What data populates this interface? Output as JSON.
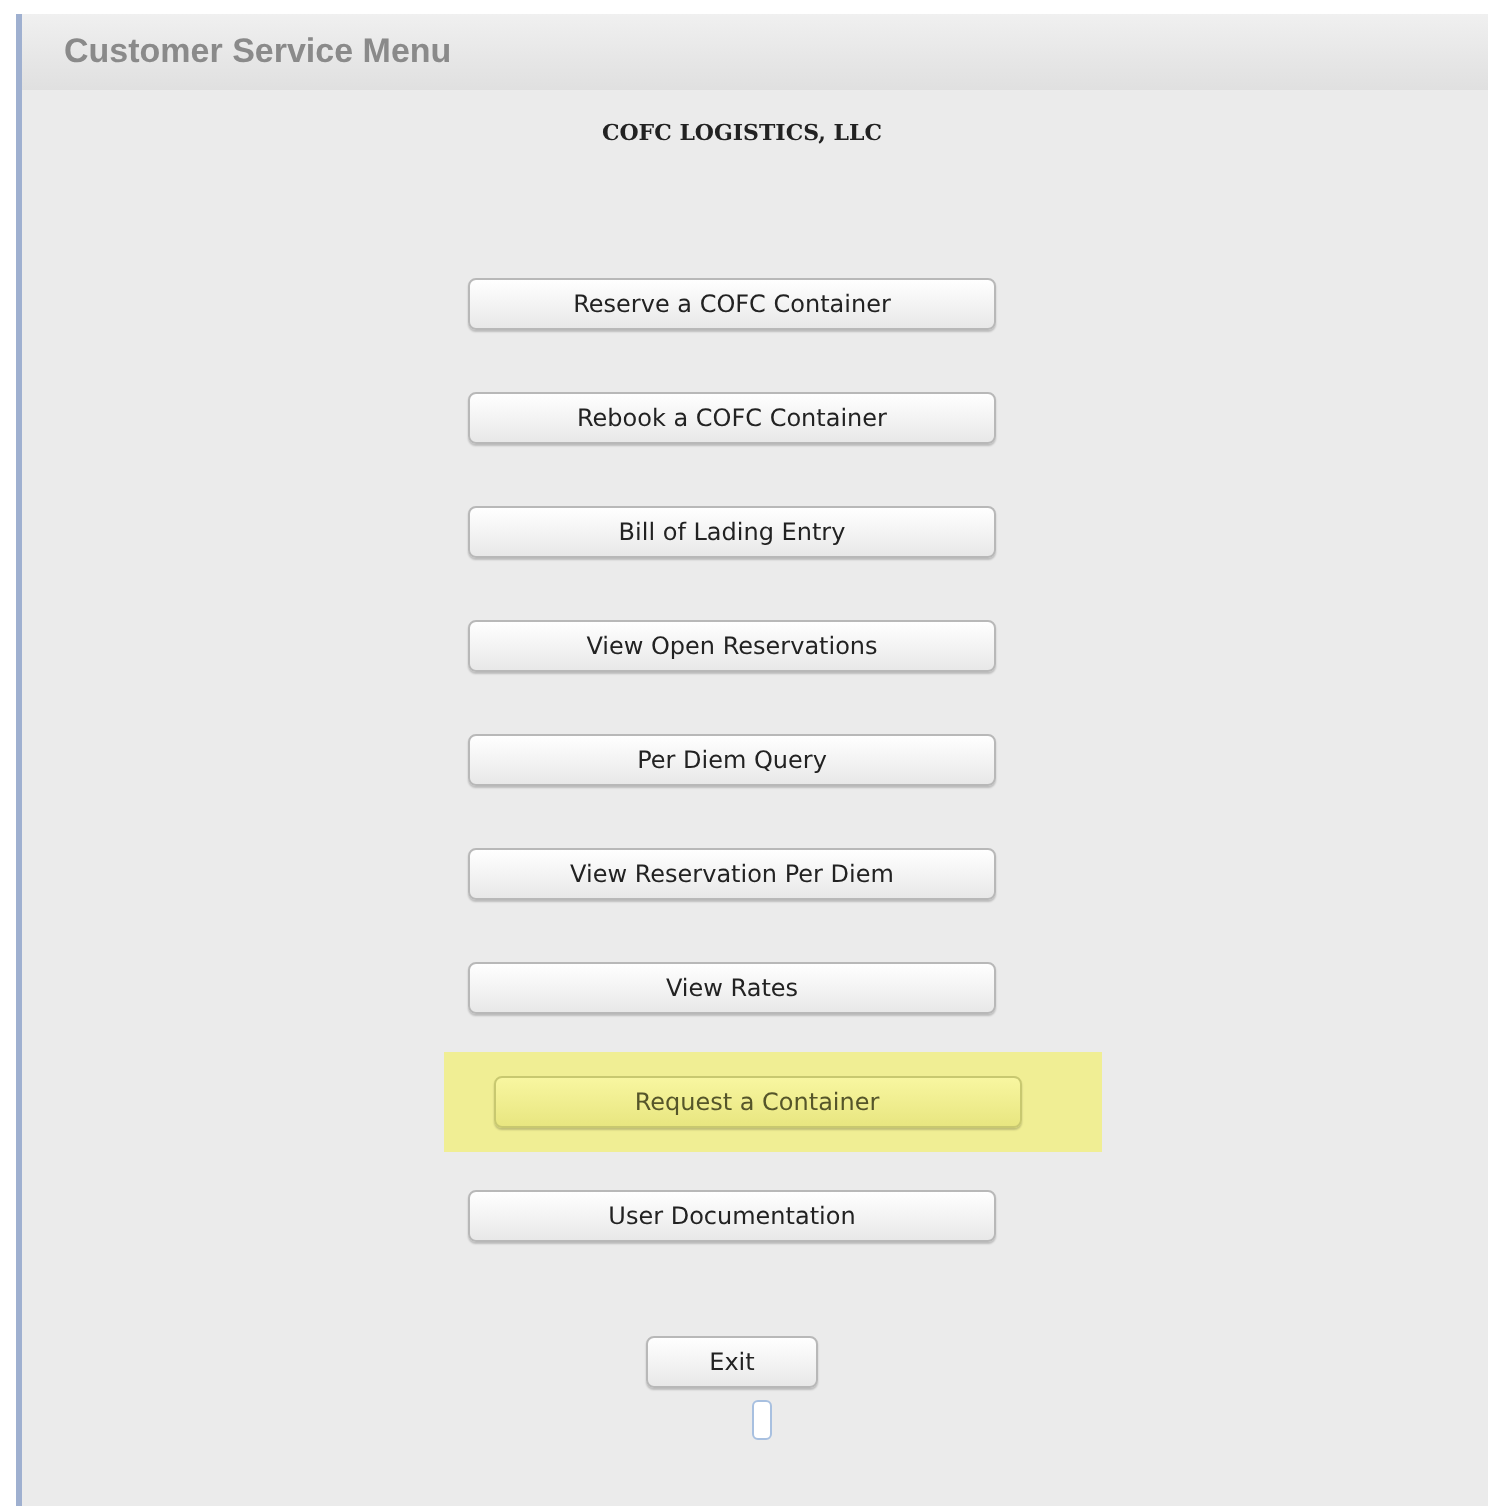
{
  "header": {
    "title": "Customer Service Menu"
  },
  "company": "COFC LOGISTICS, LLC",
  "menu_buttons": [
    {
      "label": "Reserve a COFC Container",
      "highlighted": false
    },
    {
      "label": "Rebook a COFC Container",
      "highlighted": false
    },
    {
      "label": "Bill of Lading Entry",
      "highlighted": false
    },
    {
      "label": "View Open Reservations",
      "highlighted": false
    },
    {
      "label": "Per Diem Query",
      "highlighted": false
    },
    {
      "label": "View Reservation Per Diem",
      "highlighted": false
    },
    {
      "label": "View Rates",
      "highlighted": false
    },
    {
      "label": "Request a Container",
      "highlighted": true
    },
    {
      "label": "User Documentation",
      "highlighted": false
    }
  ],
  "exit_button": {
    "label": "Exit"
  }
}
